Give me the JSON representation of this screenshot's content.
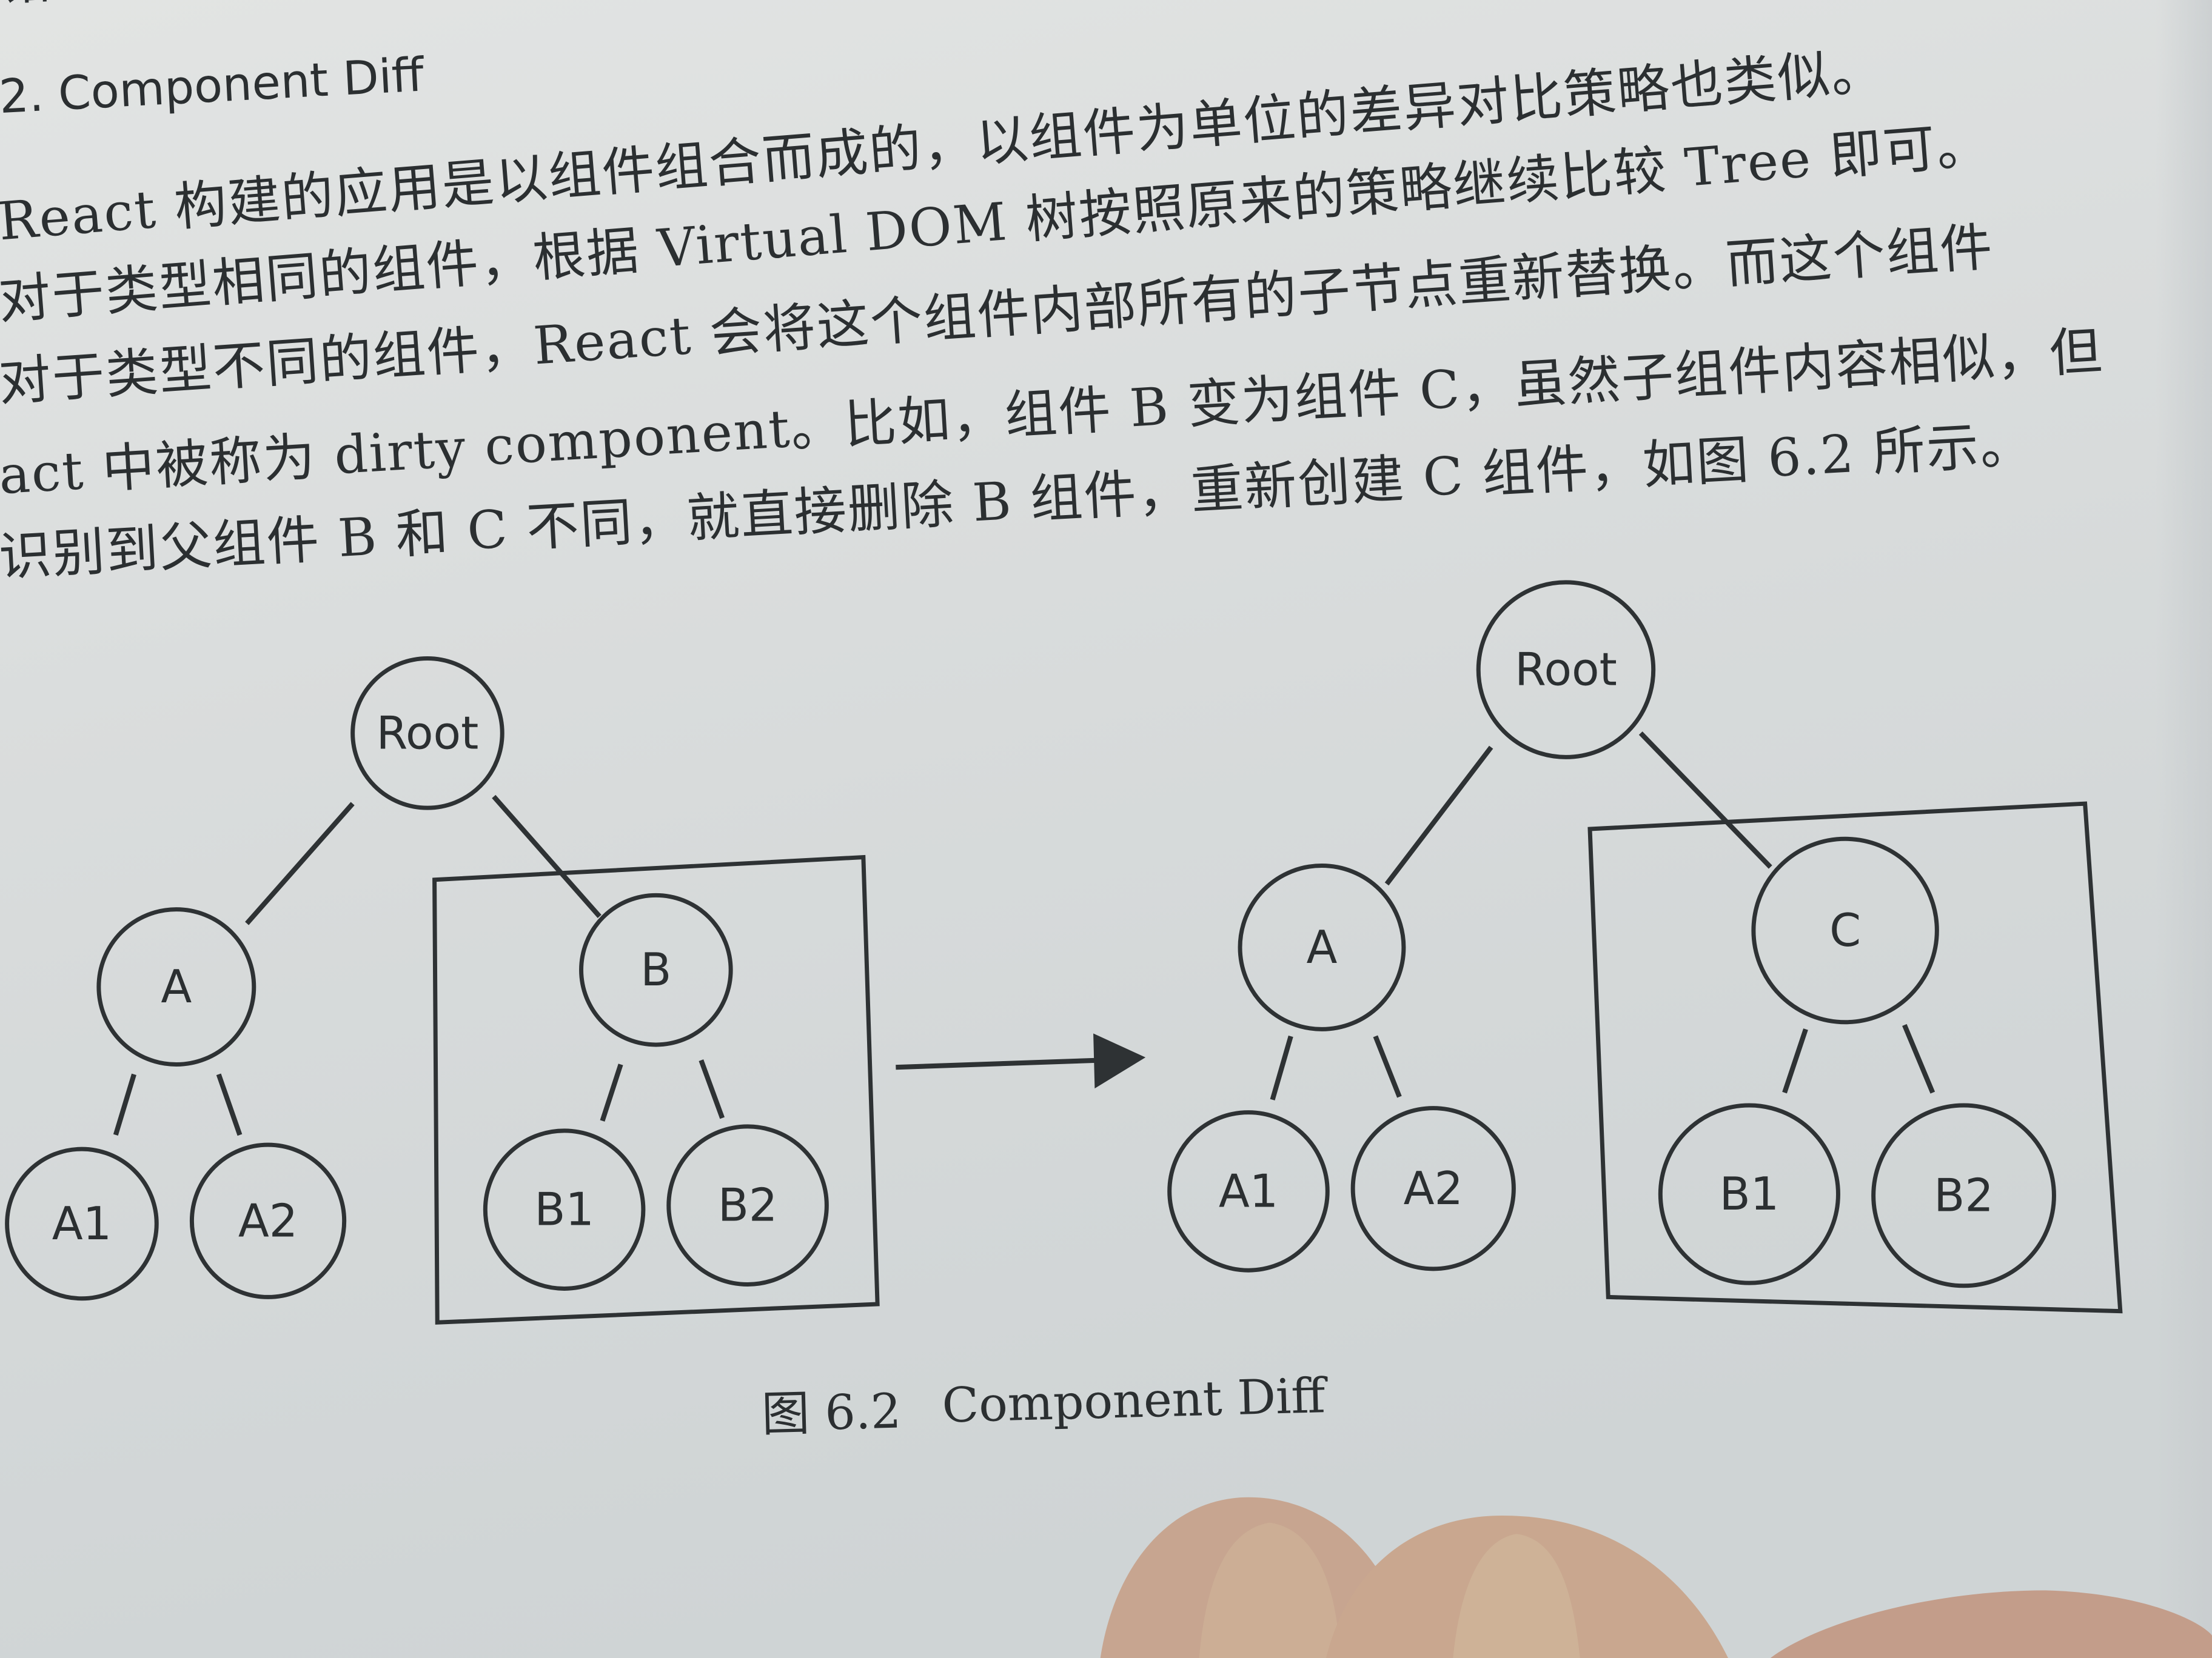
{
  "page": {
    "top_fragment": "错的方式。",
    "heading": "2. Component Diff",
    "lines": [
      "React 构建的应用是以组件组合而成的，以组件为单位的差异对比策略也类似。",
      "对于类型相同的组件，根据 Virtual DOM 树按照原来的策略继续比较 Tree 即可。",
      "对于类型不同的组件，React 会将这个组件内部所有的子节点重新替换。而这个组件",
      "act 中被称为 dirty component。比如，组件 B 变为组件 C，虽然子组件内容相似，但",
      "识别到父组件 B 和 C 不同，就直接删除 B 组件，重新创建 C 组件，如图 6.2 所示。"
    ]
  },
  "diagram": {
    "before": {
      "root": "Root",
      "a": "A",
      "a1": "A1",
      "a2": "A2",
      "b": "B",
      "b1": "B1",
      "b2": "B2"
    },
    "after": {
      "root": "Root",
      "a": "A",
      "a1": "A1",
      "a2": "A2",
      "c": "C",
      "b1": "B1",
      "b2": "B2"
    }
  },
  "caption": {
    "number": "图 6.2",
    "title": "Component Diff"
  }
}
